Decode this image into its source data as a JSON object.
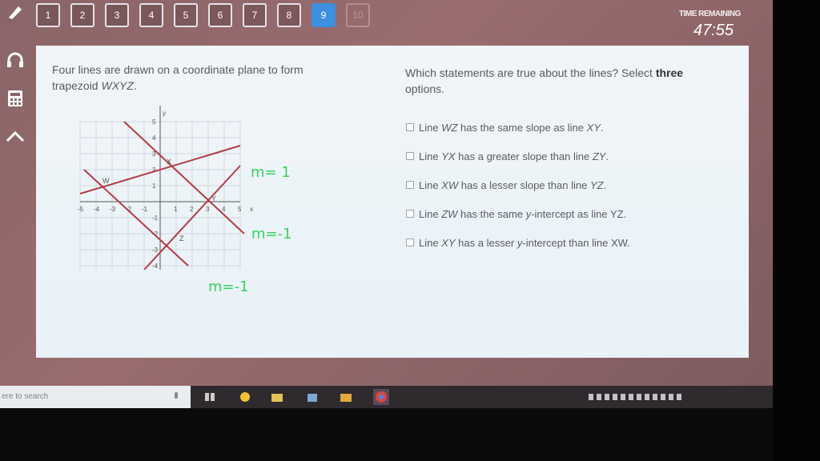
{
  "question_nav": [
    {
      "label": "1",
      "state": "normal"
    },
    {
      "label": "2",
      "state": "normal"
    },
    {
      "label": "3",
      "state": "normal"
    },
    {
      "label": "4",
      "state": "normal"
    },
    {
      "label": "5",
      "state": "normal"
    },
    {
      "label": "6",
      "state": "normal"
    },
    {
      "label": "7",
      "state": "normal"
    },
    {
      "label": "8",
      "state": "normal"
    },
    {
      "label": "9",
      "state": "active"
    },
    {
      "label": "10",
      "state": "disabled"
    }
  ],
  "timer": {
    "label": "TIME REMAINING",
    "value": "47:55"
  },
  "sidebar": {
    "icons": [
      "headphones-icon",
      "calculator-icon",
      "collapse-up-icon"
    ]
  },
  "prompt": {
    "left_text_1": "Four lines are drawn on a coordinate plane to form",
    "left_text_2": "trapezoid ",
    "left_text_italic": "WXYZ",
    "left_text_end": ".",
    "right_text_1": "Which statements are true about the lines? Select ",
    "right_text_bold": "three",
    "right_text_2": "options."
  },
  "options": [
    {
      "pre": "Line ",
      "it1": "WZ",
      "mid": " has the same slope as line ",
      "it2": "XY",
      "post": "."
    },
    {
      "pre": "Line ",
      "it1": "YX",
      "mid": " has a greater slope than line ",
      "it2": "ZY",
      "post": "."
    },
    {
      "pre": "Line ",
      "it1": "XW",
      "mid": " has a lesser slope than line ",
      "it2": "YZ",
      "post": "."
    },
    {
      "pre": "Line ",
      "it1": "ZW",
      "mid": " has the same ",
      "it2": "y",
      "post": "-intercept as line YZ."
    },
    {
      "pre": "Line ",
      "it1": "XY",
      "mid": " has a lesser ",
      "it2": "y",
      "post": "-intercept than line XW."
    }
  ],
  "graph": {
    "x_label": "x",
    "y_label": "y",
    "x_ticks": [
      "-5",
      "-4",
      "-3",
      "-2",
      "-1",
      "1",
      "2",
      "3",
      "4",
      "5"
    ],
    "y_ticks": [
      "5",
      "4",
      "3",
      "2",
      "1",
      "-1",
      "-2",
      "-3",
      "-4",
      "-5"
    ],
    "points": {
      "W": "W",
      "X": "X",
      "Y": "Y",
      "Z": "Z"
    },
    "line_color": "#b33b46"
  },
  "annotations": {
    "m1": "m= 1",
    "m2": "m=-1",
    "m3": "m=-1",
    "color": "#35d35b"
  },
  "taskbar": {
    "search_text": "ere to search"
  }
}
